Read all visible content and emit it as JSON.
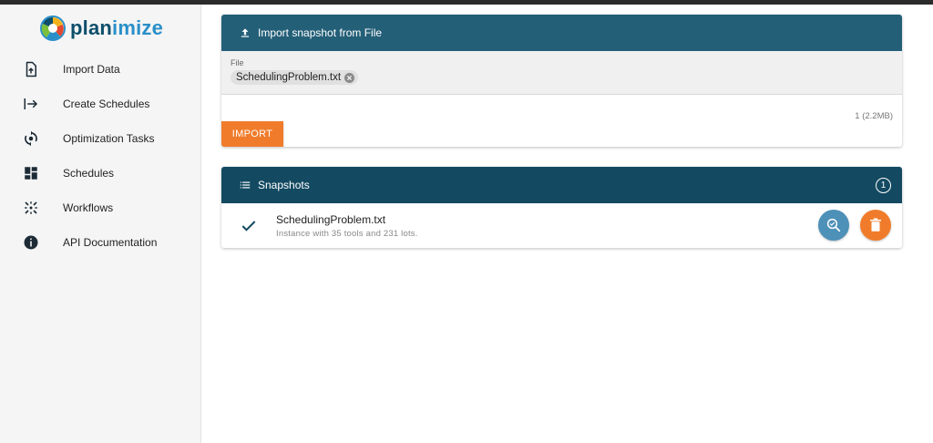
{
  "app": {
    "logo_part1": "plan",
    "logo_part2": "imize"
  },
  "sidebar": {
    "items": [
      {
        "label": "Import Data",
        "icon": "file-upload-icon"
      },
      {
        "label": "Create Schedules",
        "icon": "arrow-right-bar-icon"
      },
      {
        "label": "Optimization Tasks",
        "icon": "sync-icon"
      },
      {
        "label": "Schedules",
        "icon": "dashboard-icon"
      },
      {
        "label": "Workflows",
        "icon": "workflow-icon"
      },
      {
        "label": "API Documentation",
        "icon": "info-icon"
      }
    ]
  },
  "import_card": {
    "title": "Import snapshot from File",
    "file_label": "File",
    "file_name": "SchedulingProblem.txt",
    "file_count": "1 (2.2MB)",
    "import_label": "IMPORT"
  },
  "snapshots_card": {
    "title": "Snapshots",
    "count": "1",
    "items": [
      {
        "name": "SchedulingProblem.txt",
        "description": "Instance with 35 tools and 231 lots."
      }
    ]
  },
  "colors": {
    "import_header": "#245f78",
    "snapshots_header": "#134a62",
    "accent_orange": "#f07c2b",
    "inspect_blue": "#4d90b8"
  }
}
